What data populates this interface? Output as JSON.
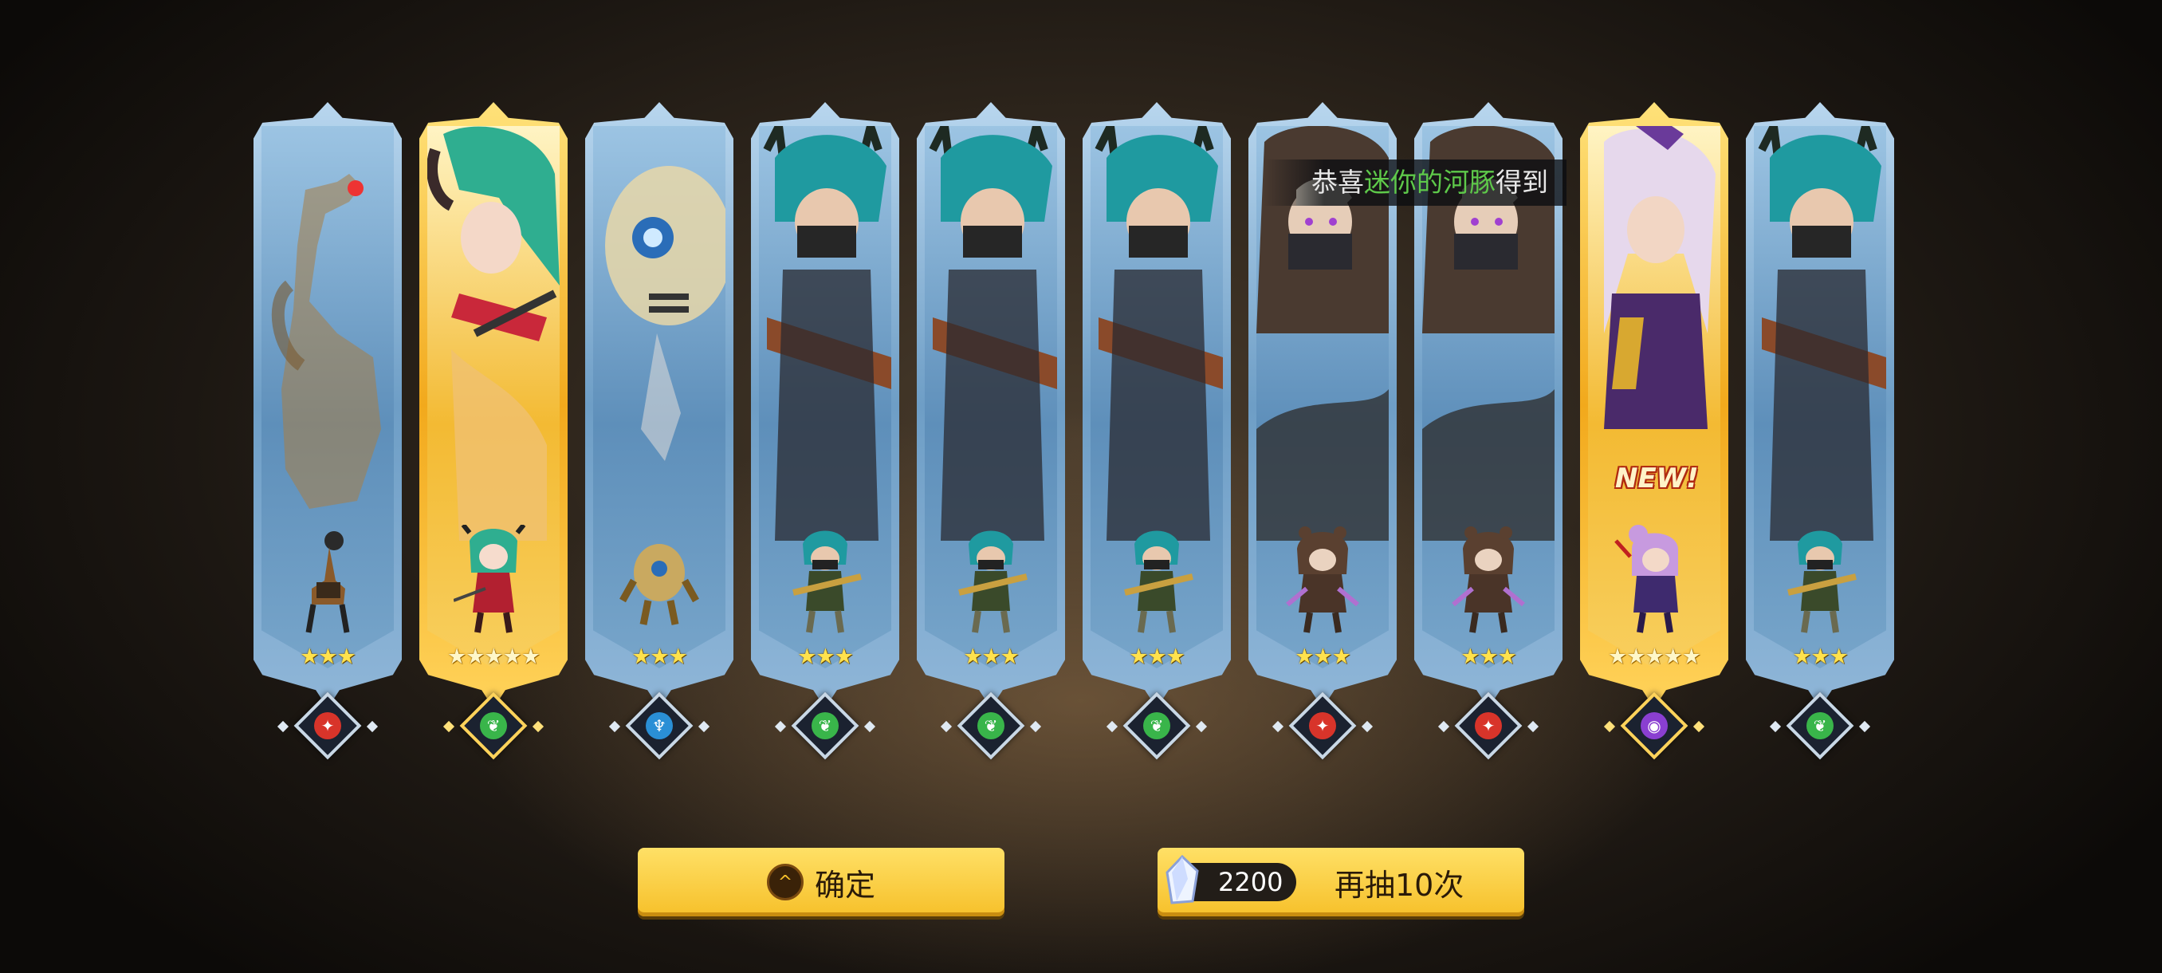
{
  "cards": [
    {
      "name": "bronze-robot-dog",
      "rarity": "common",
      "stars": "★★★",
      "element": "fire",
      "element_color": "#d8342a",
      "element_glyph": "✦",
      "is_new": false
    },
    {
      "name": "green-hair-demon-girl",
      "rarity": "rare",
      "stars": "★★★★★",
      "element": "nature",
      "element_color": "#39b54a",
      "element_glyph": "❦",
      "is_new": false
    },
    {
      "name": "eyeball-robot",
      "rarity": "common",
      "stars": "★★★",
      "element": "water",
      "element_color": "#2a8fd6",
      "element_glyph": "♆",
      "is_new": false
    },
    {
      "name": "masked-rifleman",
      "rarity": "common",
      "stars": "★★★",
      "element": "nature",
      "element_color": "#39b54a",
      "element_glyph": "❦",
      "is_new": false
    },
    {
      "name": "masked-rifleman",
      "rarity": "common",
      "stars": "★★★",
      "element": "nature",
      "element_color": "#39b54a",
      "element_glyph": "❦",
      "is_new": false
    },
    {
      "name": "masked-rifleman",
      "rarity": "common",
      "stars": "★★★",
      "element": "nature",
      "element_color": "#39b54a",
      "element_glyph": "❦",
      "is_new": false
    },
    {
      "name": "hooded-assassin",
      "rarity": "common",
      "stars": "★★★",
      "element": "fire",
      "element_color": "#d8342a",
      "element_glyph": "✦",
      "is_new": false
    },
    {
      "name": "hooded-assassin",
      "rarity": "common",
      "stars": "★★★",
      "element": "fire",
      "element_color": "#d8342a",
      "element_glyph": "✦",
      "is_new": false
    },
    {
      "name": "purple-sorceress",
      "rarity": "rare",
      "stars": "★★★★★",
      "element": "dark",
      "element_color": "#8a3fd1",
      "element_glyph": "◉",
      "is_new": true
    },
    {
      "name": "masked-rifleman",
      "rarity": "common",
      "stars": "★★★",
      "element": "nature",
      "element_color": "#39b54a",
      "element_glyph": "❦",
      "is_new": false
    }
  ],
  "new_badge": "NEW!",
  "toast": {
    "prefix": "恭喜",
    "highlight": "迷你的河豚",
    "suffix": "得到"
  },
  "confirm_button": {
    "label": "确定",
    "icon": "chevron-up-icon"
  },
  "redraw_button": {
    "cost": "2200",
    "label": "再抽10次",
    "icon": "crystal-icon"
  },
  "colors": {
    "button": "#f6c02a",
    "frame_blue": "#8fb6d8",
    "frame_gold": "#f2a91c",
    "toast_highlight": "#5ec94a"
  }
}
